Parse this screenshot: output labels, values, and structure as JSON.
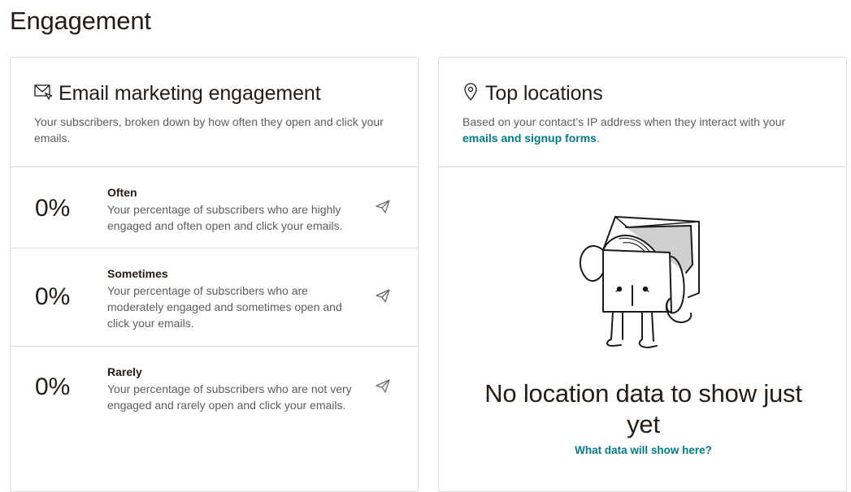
{
  "page": {
    "title": "Engagement"
  },
  "email_card": {
    "icon": "envelope-icon",
    "title": "Email marketing engagement",
    "description": "Your subscribers, broken down by how often they open and click your emails.",
    "rows": [
      {
        "percent": "0%",
        "label": "Often",
        "text": "Your percentage of subscribers who are highly engaged and often open and click your emails.",
        "icon": "send-icon"
      },
      {
        "percent": "0%",
        "label": "Sometimes",
        "text": "Your percentage of subscribers who are moderately engaged and sometimes open and click your emails.",
        "icon": "send-icon"
      },
      {
        "percent": "0%",
        "label": "Rarely",
        "text": "Your percentage of subscribers who are not very engaged and rarely open and click your emails.",
        "icon": "send-icon"
      }
    ]
  },
  "locations_card": {
    "icon": "location-pin-icon",
    "title": "Top locations",
    "description_prefix": "Based on your contact’s IP address when they interact with your ",
    "description_link": "emails and signup forms",
    "description_suffix": ".",
    "empty_illustration": "box-character-illustration",
    "empty_title": "No location data to show just yet",
    "empty_link": "What data will show here?"
  },
  "colors": {
    "link": "#007c89",
    "text": "#241c15",
    "muted": "#5c5c5c",
    "border": "#dcdcdc"
  }
}
